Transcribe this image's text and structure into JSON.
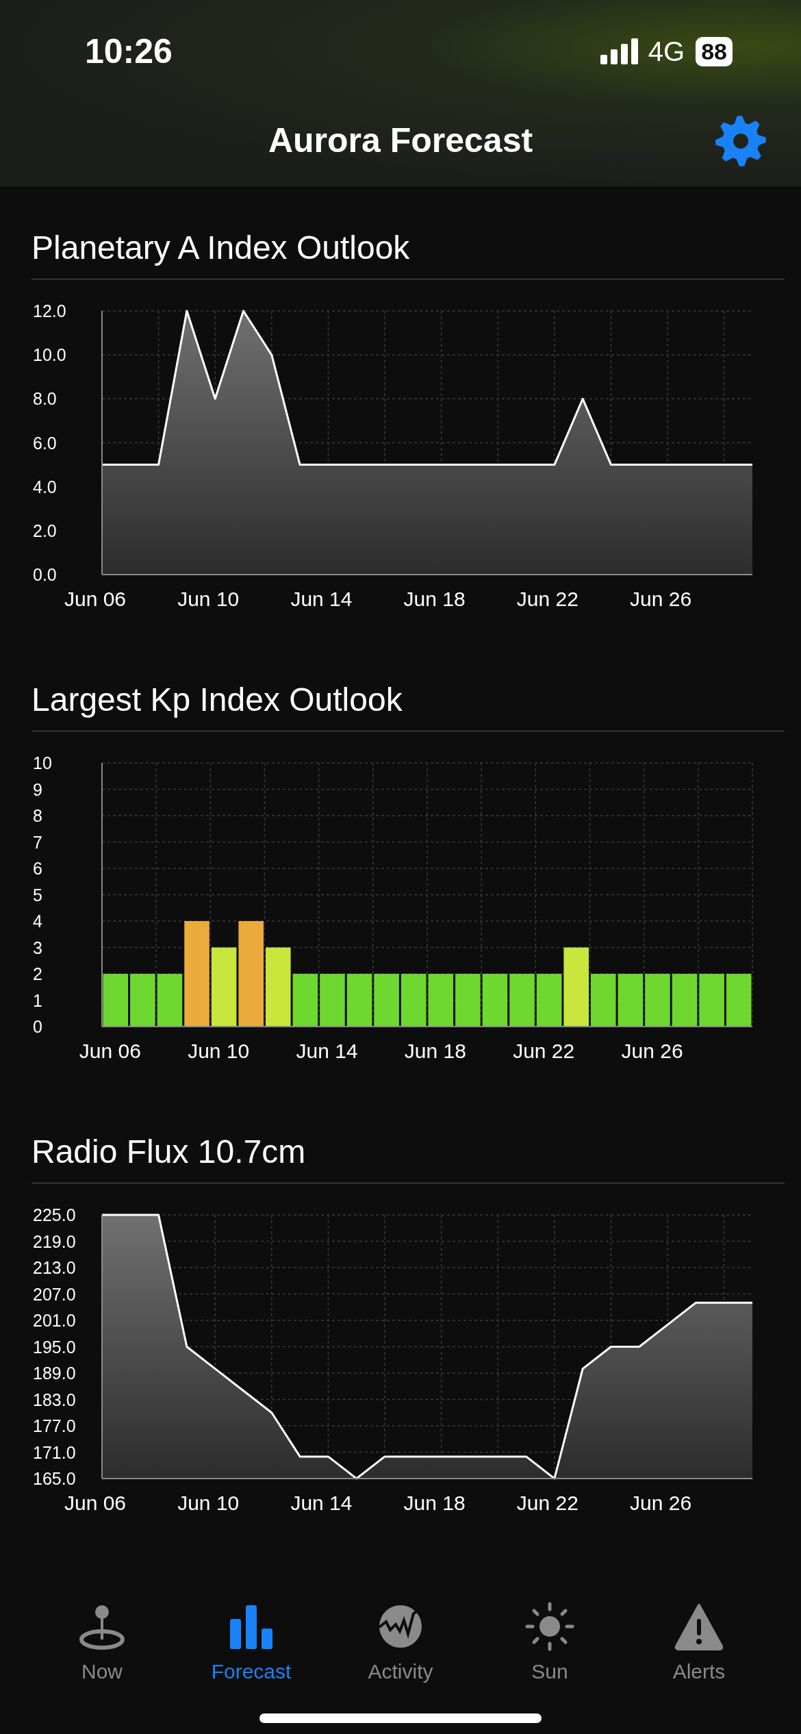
{
  "status_bar": {
    "time": "10:26",
    "network": "4G",
    "battery": "88"
  },
  "header": {
    "title": "Aurora Forecast"
  },
  "sections": [
    {
      "title": "Planetary A Index Outlook",
      "chart_data": {
        "type": "area",
        "grid": true,
        "categories": [
          "Jun 06",
          null,
          null,
          null,
          "Jun 10",
          null,
          null,
          null,
          "Jun 14",
          null,
          null,
          null,
          "Jun 18",
          null,
          null,
          null,
          "Jun 22",
          null,
          null,
          null,
          "Jun 26",
          null,
          null,
          null
        ],
        "series": [
          {
            "values": [
              5,
              5,
              5,
              12,
              8,
              12,
              10,
              5,
              5,
              5,
              5,
              5,
              5,
              5,
              5,
              5,
              5,
              8,
              5,
              5,
              5,
              5,
              5,
              5
            ]
          }
        ],
        "ylim": [
          0,
          12
        ],
        "yticks": [
          {
            "value": 0,
            "label": "0.0"
          },
          {
            "value": 2,
            "label": "2.0"
          },
          {
            "value": 4,
            "label": "4.0"
          },
          {
            "value": 6,
            "label": "6.0"
          },
          {
            "value": 8,
            "label": "8.0"
          },
          {
            "value": 10,
            "label": "10.0"
          },
          {
            "value": 12,
            "label": "12.0"
          }
        ]
      }
    },
    {
      "title": "Largest Kp Index Outlook",
      "chart_data": {
        "type": "bar",
        "grid": true,
        "categories": [
          "Jun 06",
          null,
          null,
          null,
          "Jun 10",
          null,
          null,
          null,
          "Jun 14",
          null,
          null,
          null,
          "Jun 18",
          null,
          null,
          null,
          "Jun 22",
          null,
          null,
          null,
          "Jun 26",
          null,
          null,
          null
        ],
        "series": [
          {
            "values": [
              2,
              2,
              2,
              4,
              3,
              4,
              3,
              2,
              2,
              2,
              2,
              2,
              2,
              2,
              2,
              2,
              2,
              3,
              2,
              2,
              2,
              2,
              2,
              2
            ]
          }
        ],
        "ylim": [
          0,
          10
        ],
        "yticks": [
          0,
          1,
          2,
          3,
          4,
          5,
          6,
          7,
          8,
          9,
          10
        ]
      }
    },
    {
      "title": "Radio Flux 10.7cm",
      "chart_data": {
        "type": "area",
        "grid": true,
        "categories": [
          "Jun 06",
          null,
          null,
          null,
          "Jun 10",
          null,
          null,
          null,
          "Jun 14",
          null,
          null,
          null,
          "Jun 18",
          null,
          null,
          null,
          "Jun 22",
          null,
          null,
          null,
          "Jun 26",
          null,
          null,
          null
        ],
        "series": [
          {
            "values": [
              225,
              225,
              225,
              195,
              190,
              185,
              180,
              170,
              170,
              165,
              170,
              170,
              170,
              170,
              170,
              170,
              165,
              190,
              195,
              195,
              200,
              205,
              205,
              205
            ]
          }
        ],
        "ylim": [
          165,
          225
        ],
        "yticks": [
          {
            "value": 165,
            "label": "165.0"
          },
          {
            "value": 171,
            "label": "171.0"
          },
          {
            "value": 177,
            "label": "177.0"
          },
          {
            "value": 183,
            "label": "183.0"
          },
          {
            "value": 189,
            "label": "189.0"
          },
          {
            "value": 195,
            "label": "195.0"
          },
          {
            "value": 201,
            "label": "201.0"
          },
          {
            "value": 207,
            "label": "207.0"
          },
          {
            "value": 213,
            "label": "213.0"
          },
          {
            "value": 219,
            "label": "219.0"
          },
          {
            "value": 225,
            "label": "225.0"
          }
        ]
      }
    }
  ],
  "tabs": [
    {
      "label": "Now",
      "selected": false
    },
    {
      "label": "Forecast",
      "selected": true
    },
    {
      "label": "Activity",
      "selected": false
    },
    {
      "label": "Sun",
      "selected": false
    },
    {
      "label": "Alerts",
      "selected": false
    }
  ]
}
